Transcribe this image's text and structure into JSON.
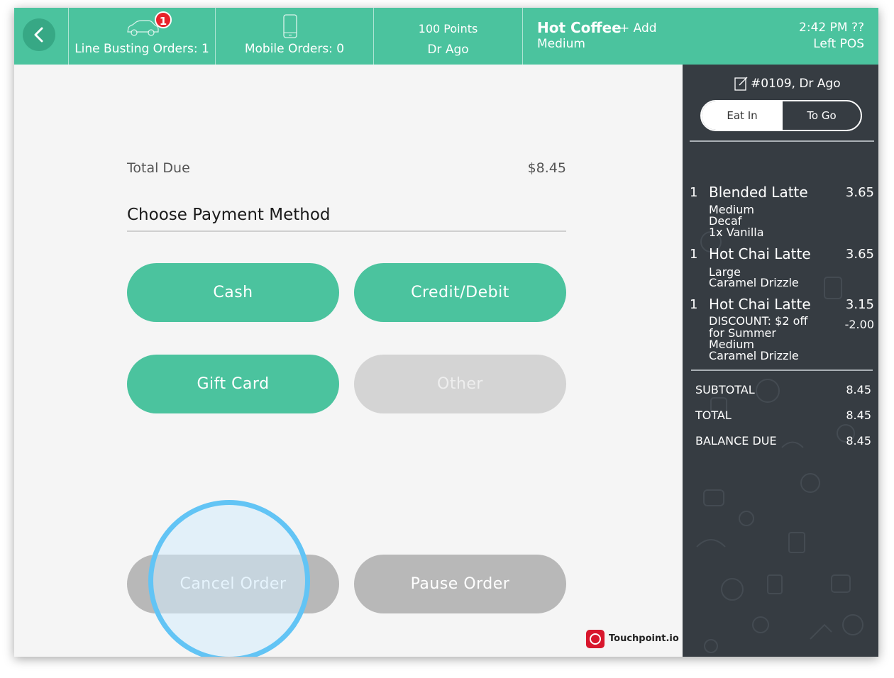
{
  "header": {
    "line_busting_badge": "1",
    "line_busting_label": "Line Busting Orders: 1",
    "mobile_orders_label": "Mobile Orders: 0",
    "customer_points": "100 Points",
    "customer_name": "Dr Ago",
    "item_title": "Hot Coffee",
    "add_label": "+ Add",
    "item_size": "Medium",
    "time": "2:42 PM  ??",
    "pos_name": "Left POS"
  },
  "payment": {
    "total_due_label": "Total Due",
    "total_due_amount": "$8.45",
    "heading": "Choose Payment Method",
    "cash": "Cash",
    "credit": "Credit/Debit",
    "gift": "Gift Card",
    "other": "Other",
    "cancel": "Cancel Order",
    "pause": "Pause Order"
  },
  "brand": {
    "name": "Touchpoint.io"
  },
  "order": {
    "number": "#0109, Dr Ago",
    "eat_in": "Eat In",
    "to_go": "To Go",
    "items": [
      {
        "qty": "1",
        "name": "Blended Latte",
        "price": "3.65",
        "mods": [
          "Medium",
          "Decaf",
          "1x Vanilla"
        ]
      },
      {
        "qty": "1",
        "name": "Hot Chai Latte",
        "price": "3.65",
        "mods": [
          "Large",
          "Caramel Drizzle"
        ]
      },
      {
        "qty": "1",
        "name": "Hot Chai Latte",
        "price": "3.15",
        "discount": "-2.00",
        "mods": [
          "DISCOUNT: $2 off",
          "for Summer",
          "Medium",
          "Caramel Drizzle"
        ]
      }
    ],
    "subtotal_label": "SUBTOTAL",
    "subtotal": "8.45",
    "total_label": "TOTAL",
    "total": "8.45",
    "balance_label": "BALANCE DUE",
    "balance": "8.45"
  },
  "colors": {
    "accent": "#4bc39e",
    "sidebar_bg": "#363c42",
    "badge": "#e8232b",
    "touch_indicator": "#62c4f5"
  },
  "icons": {
    "back": "chevron-left-icon",
    "car": "car-icon",
    "phone": "phone-icon",
    "note": "edit-note-icon",
    "brand": "touchpoint-logo-icon"
  }
}
